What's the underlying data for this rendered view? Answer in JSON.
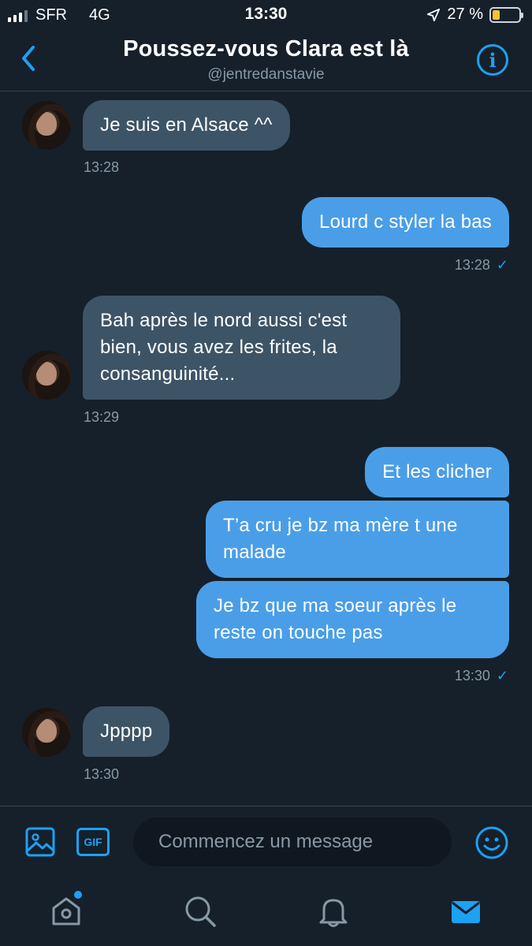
{
  "status_bar": {
    "carrier": "SFR",
    "network": "4G",
    "time": "13:30",
    "battery": "27 %",
    "battery_level": 0.27
  },
  "header": {
    "title": "Poussez-vous Clara est là",
    "handle": "@jentredanstavie",
    "back_icon": "chevron-left-icon",
    "info_icon": "info-icon",
    "info_label": "i"
  },
  "messages": [
    {
      "side": "in",
      "text": "Je suis en Alsace ^^"
    },
    {
      "side": "in",
      "time": "13:28"
    },
    {
      "side": "out",
      "text": "Lourd c styler la bas"
    },
    {
      "side": "out",
      "time": "13:28"
    },
    {
      "side": "in",
      "text": "Bah après le nord aussi c'est bien, vous avez les frites, la consanguinité..."
    },
    {
      "side": "in",
      "time": "13:29"
    },
    {
      "side": "out",
      "text": "Et les clicher"
    },
    {
      "side": "out",
      "text": "T’a cru je bz ma mère t une malade"
    },
    {
      "side": "out",
      "text": "Je bz que ma soeur après le reste on touche pas"
    },
    {
      "side": "out",
      "time": "13:30"
    },
    {
      "side": "in",
      "text": "Jpppp"
    },
    {
      "side": "in",
      "time": "13:30"
    }
  ],
  "read_mark": "✓",
  "composer": {
    "placeholder": "Commencez un message",
    "gif_label": "GIF",
    "media_icon": "image-icon",
    "emoji_icon": "smiley-icon"
  },
  "colors": {
    "background": "#15202b",
    "incoming_bubble": "#3d5466",
    "outgoing_bubble": "#4a9ee8",
    "accent": "#1da1f2",
    "muted_text": "#8899a6"
  },
  "tabbar": {
    "items": [
      "home-icon",
      "search-icon",
      "bell-icon",
      "mail-icon"
    ],
    "active": "mail-icon"
  }
}
